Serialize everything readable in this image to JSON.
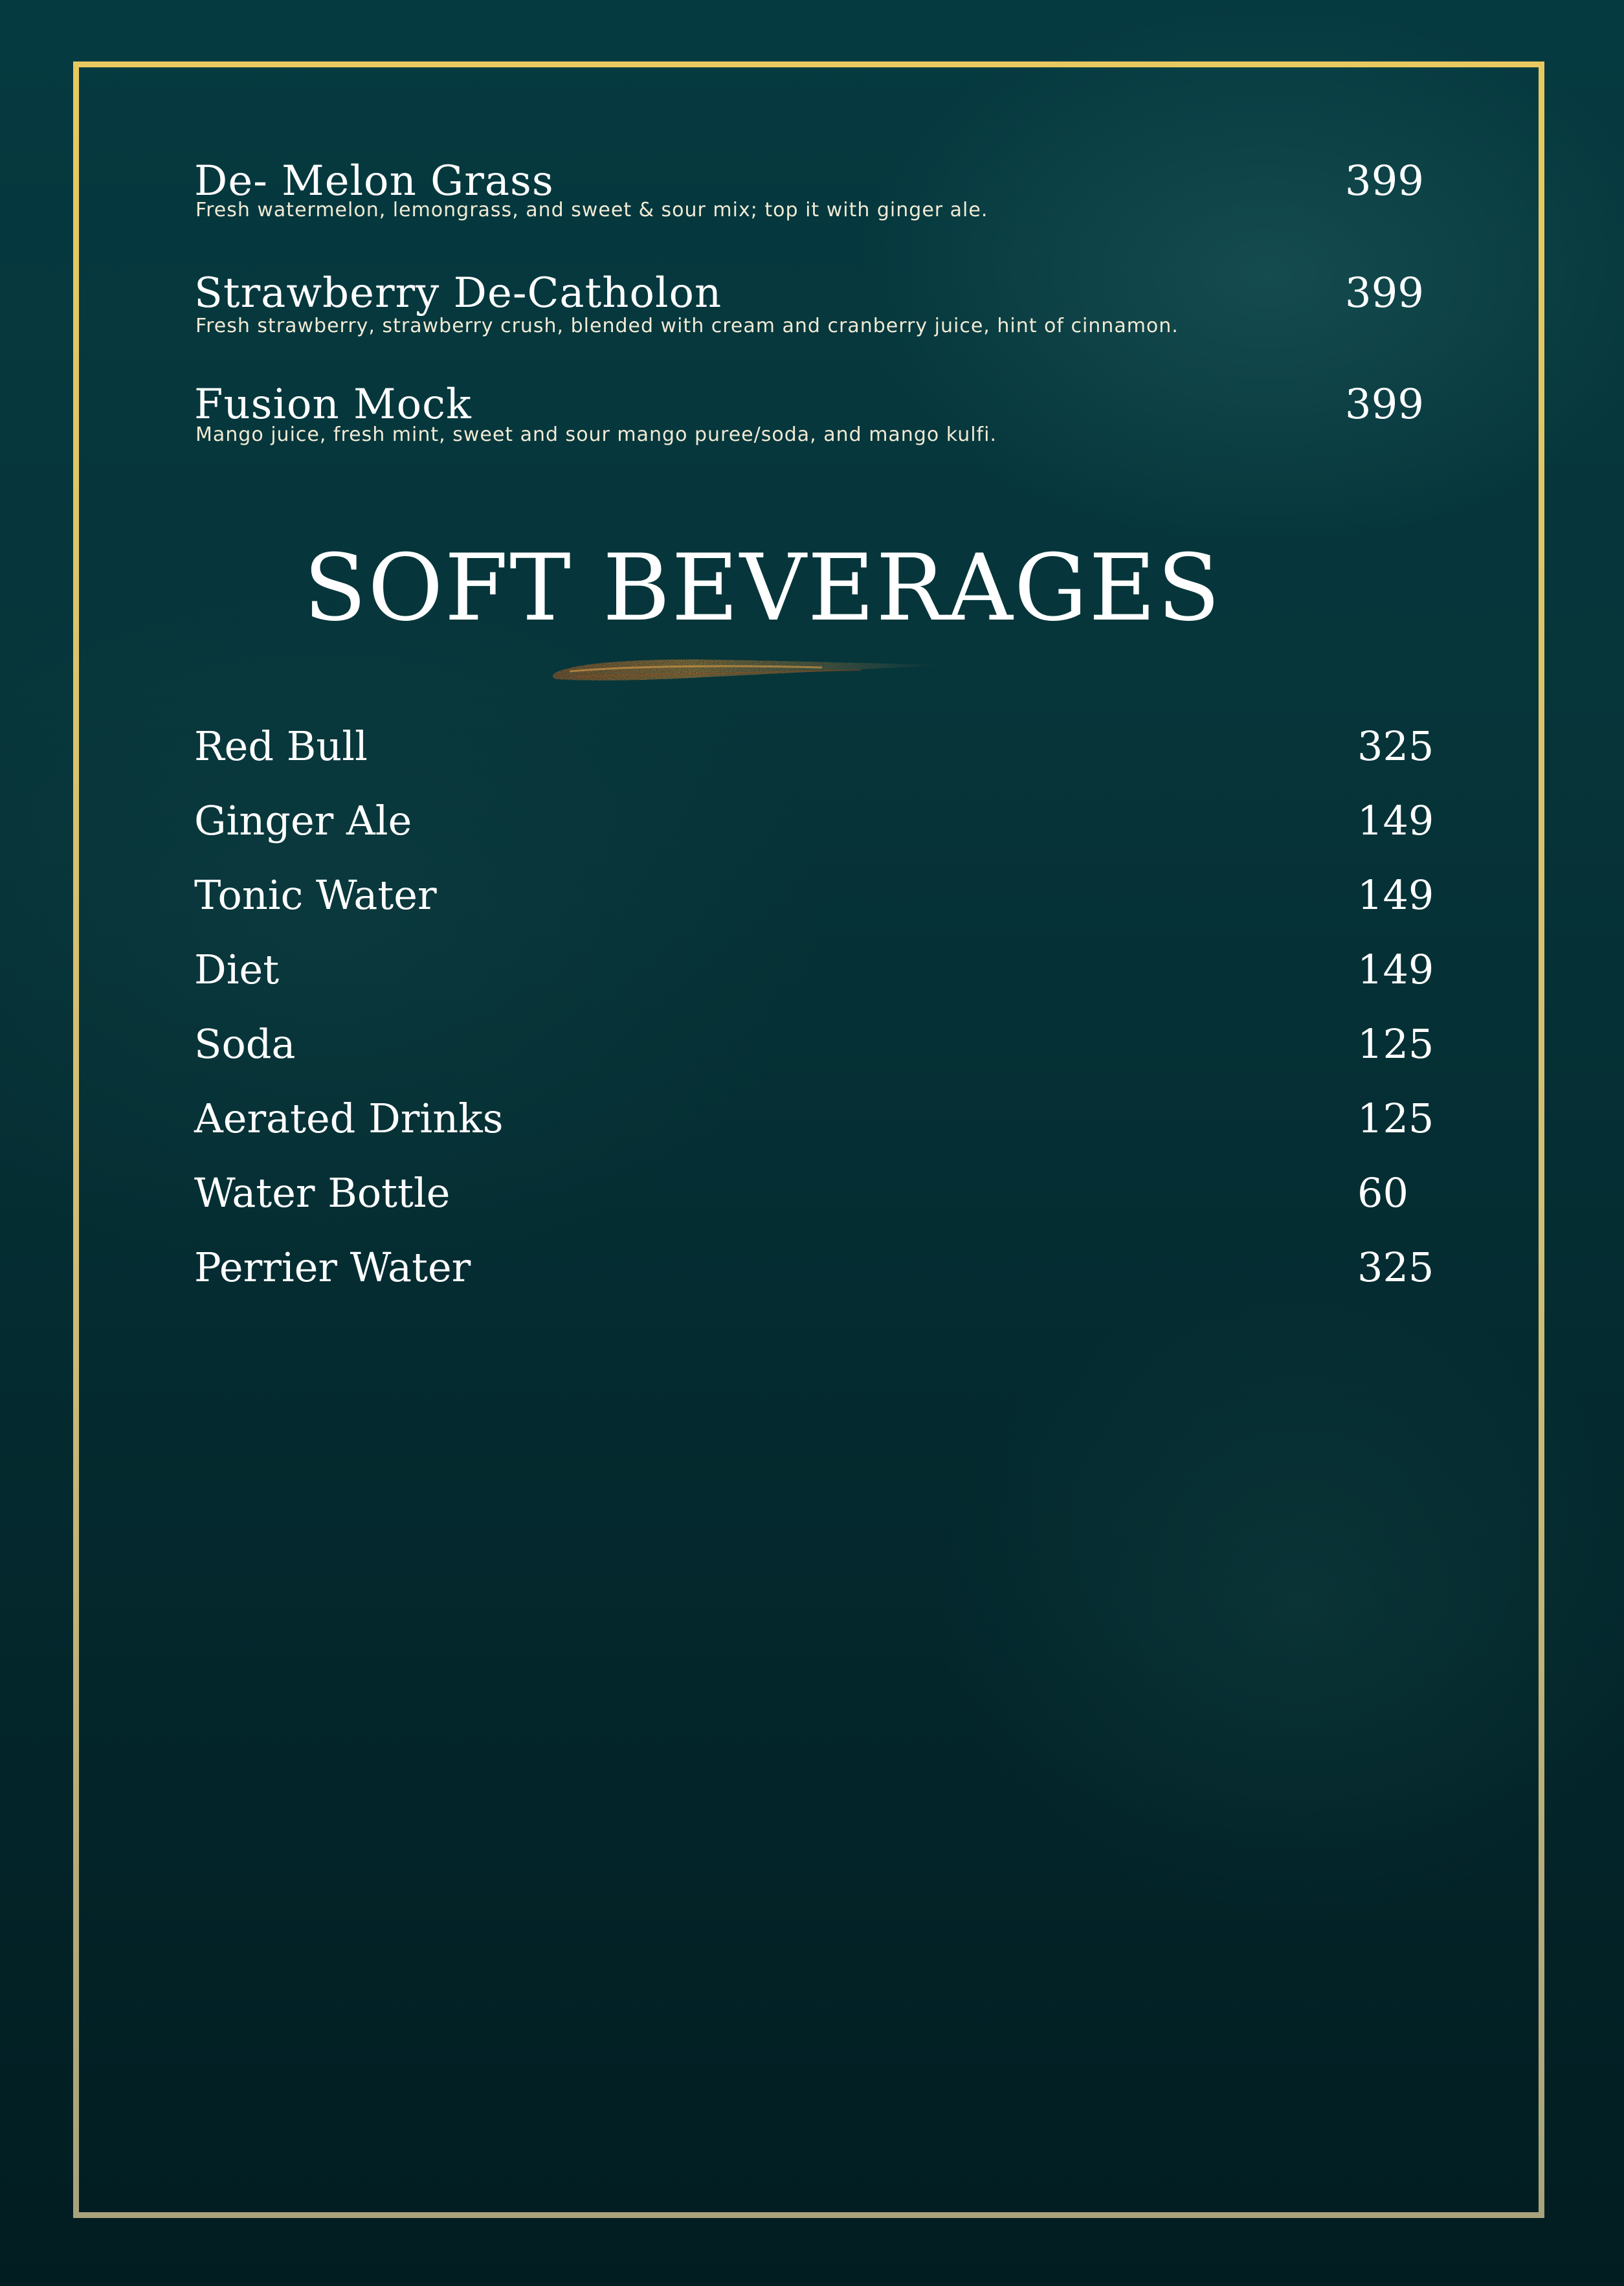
{
  "mocktails": [
    {
      "name": "De- Melon Grass",
      "price": "399",
      "description": "Fresh watermelon, lemongrass, and sweet & sour mix; top it with ginger ale."
    },
    {
      "name": "Strawberry De-Catholon",
      "price": "399",
      "description": "Fresh strawberry, strawberry crush, blended with cream and cranberry juice, hint of cinnamon."
    },
    {
      "name": "Fusion Mock",
      "price": "399",
      "description": "Mango juice, fresh mint, sweet and sour mango puree/soda, and mango kulfi."
    }
  ],
  "soft_beverages": {
    "title": "SOFT BEVERAGES",
    "items": [
      {
        "name": "Red Bull",
        "price": "325"
      },
      {
        "name": "Ginger Ale",
        "price": "149"
      },
      {
        "name": "Tonic Water",
        "price": "149"
      },
      {
        "name": "Diet",
        "price": "149"
      },
      {
        "name": "Soda",
        "price": "125"
      },
      {
        "name": "Aerated Drinks",
        "price": "125"
      },
      {
        "name": "Water Bottle",
        "price": "60"
      },
      {
        "name": "Perrier Water",
        "price": "325"
      }
    ]
  },
  "colors": {
    "background": "#053a40",
    "frame": "#d6bd66",
    "text": "#ffffff",
    "description": "#f1ead4",
    "brush_accent": "#c8742a"
  }
}
